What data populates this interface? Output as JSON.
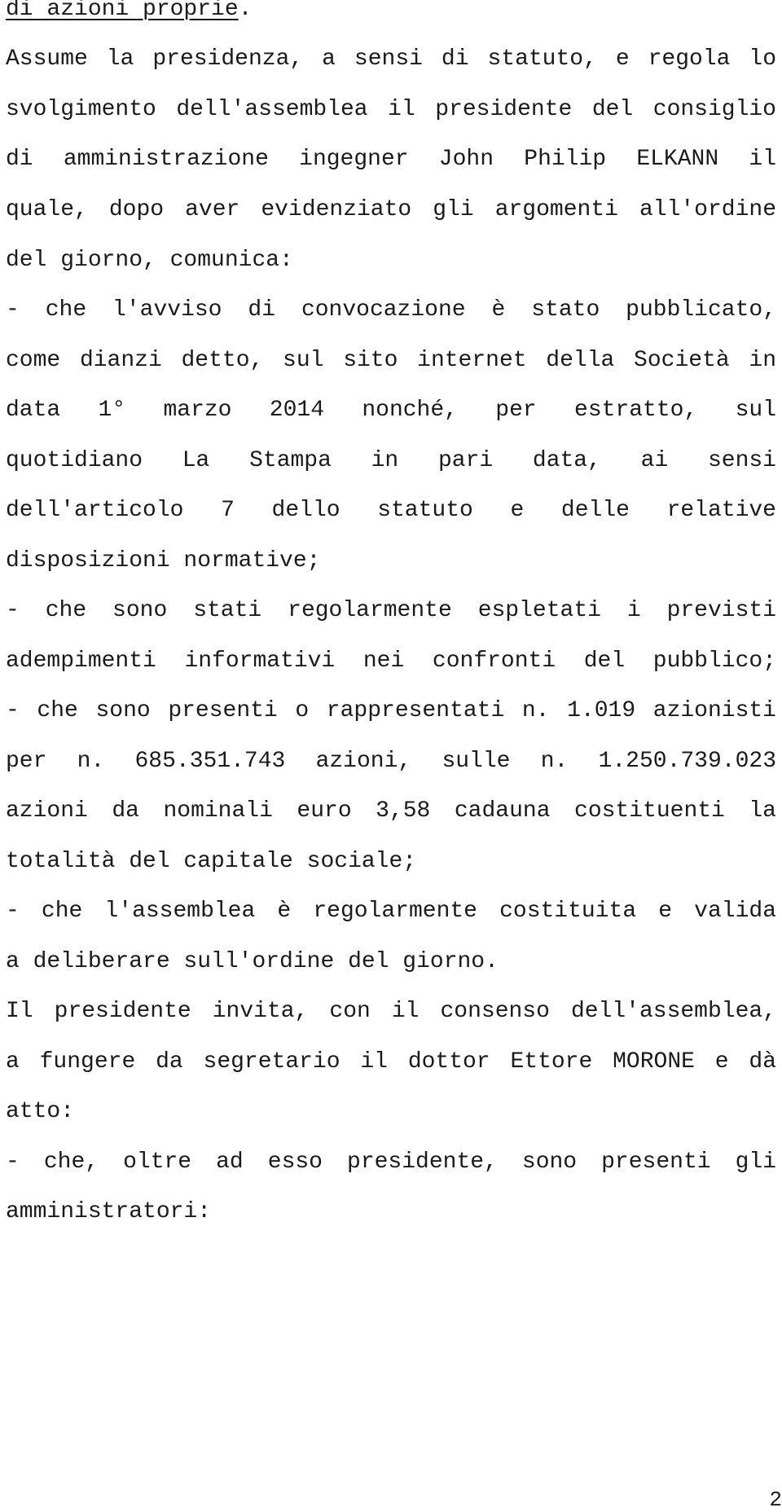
{
  "document": {
    "language": "it",
    "first_line": {
      "underlined_text": "di azioni proprie",
      "trailing_text": "."
    },
    "lines": [
      "Assume la presidenza, a sensi di statuto, e regola lo",
      "svolgimento dell'assemblea il presidente del consiglio",
      "di amministrazione ingegner John Philip ELKANN il",
      "quale, dopo aver evidenziato gli argomenti all'ordine",
      "del giorno, comunica:",
      "- che l'avviso di convocazione è stato pubblicato,",
      "come dianzi detto, sul sito internet della Società in",
      "data 1° marzo 2014 nonché, per estratto, sul",
      "quotidiano La Stampa in pari data, ai sensi",
      "dell'articolo 7 dello statuto e delle relative",
      "disposizioni normative;",
      "- che sono stati regolarmente espletati i previsti",
      "adempimenti informativi nei confronti del pubblico;",
      "- che sono presenti o rappresentati n. 1.019 azionisti",
      "per n. 685.351.743 azioni, sulle n. 1.250.739.023",
      "azioni da nominali euro 3,58 cadauna costituenti la",
      "totalità del capitale sociale;",
      "- che l'assemblea è regolarmente costituita e valida",
      "a deliberare sull'ordine del giorno.",
      "Il presidente invita, con il consenso dell'assemblea,",
      "a fungere da segretario il dottor Ettore MORONE e dà",
      "atto:",
      "- che, oltre ad esso presidente, sono presenti gli",
      "amministratori:"
    ],
    "page_number": "2"
  }
}
